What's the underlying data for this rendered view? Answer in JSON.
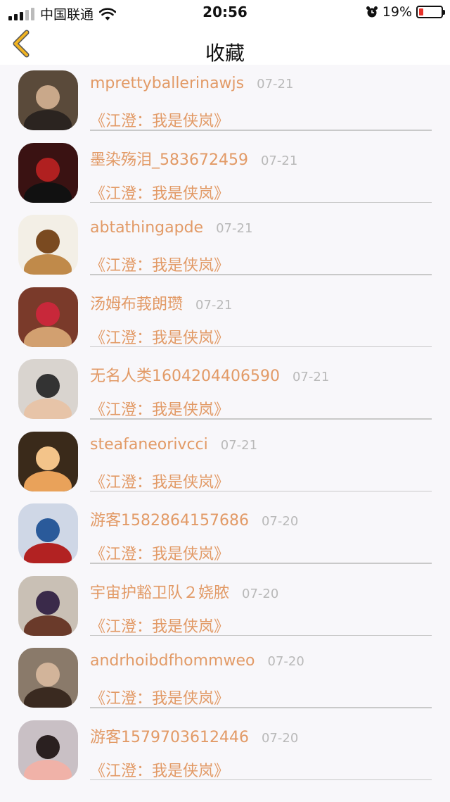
{
  "status_bar": {
    "carrier": "中国联通",
    "time": "20:56",
    "battery_percent": "19%",
    "battery_level": 0.19,
    "battery_color": "#e8322a"
  },
  "nav": {
    "title": "收藏",
    "back_icon": "chevron-left-icon",
    "accent": "#f0b322"
  },
  "items": [
    {
      "name": "mprettyballerinawjs",
      "date": "07-21",
      "title": "《江澄：我是侠岚》"
    },
    {
      "name": "墨染殇泪_583672459",
      "date": "07-21",
      "title": "《江澄：我是侠岚》"
    },
    {
      "name": "abtathingapde",
      "date": "07-21",
      "title": "《江澄：我是侠岚》"
    },
    {
      "name": "汤姆布莪朗瓒",
      "date": "07-21",
      "title": "《江澄：我是侠岚》"
    },
    {
      "name": "无名人类1604204406590",
      "date": "07-21",
      "title": "《江澄：我是侠岚》"
    },
    {
      "name": "steafaneorivcci",
      "date": "07-21",
      "title": "《江澄：我是侠岚》"
    },
    {
      "name": "游客1582864157686",
      "date": "07-20",
      "title": "《江澄：我是侠岚》"
    },
    {
      "name": "宇宙护豁卫队２娆脓",
      "date": "07-20",
      "title": "《江澄：我是侠岚》"
    },
    {
      "name": "andrhoibdfhommweo",
      "date": "07-20",
      "title": "《江澄：我是侠岚》"
    },
    {
      "name": "游客1579703612446",
      "date": "07-20",
      "title": "《江澄：我是侠岚》"
    }
  ],
  "colors": {
    "accent_text": "#e29a66",
    "date_text": "#b9b9b9",
    "divider": "#c9c9c9"
  }
}
